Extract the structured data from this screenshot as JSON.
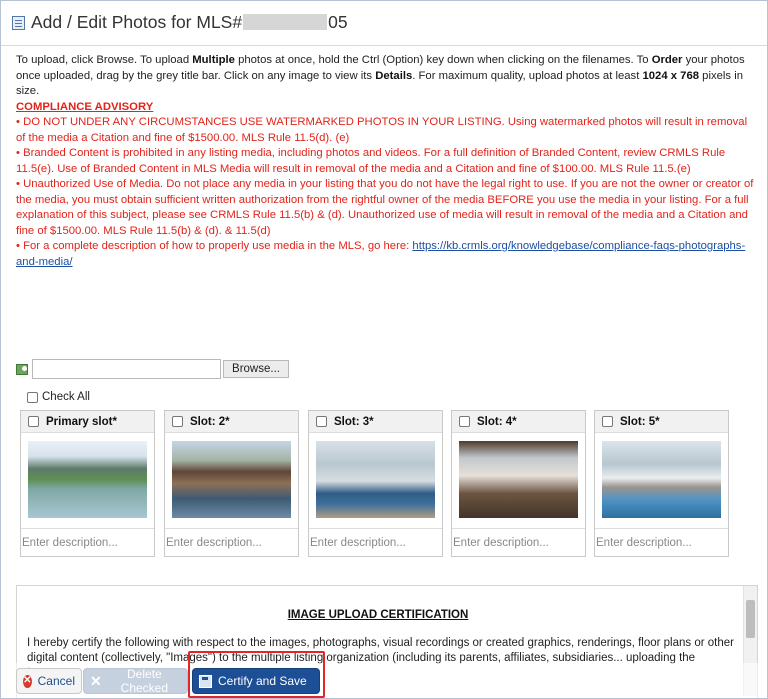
{
  "window": {
    "title_prefix": "Add / Edit Photos for MLS#",
    "title_suffix": "05"
  },
  "instructions": {
    "p1": "To upload, click Browse. To upload ",
    "b1": "Multiple",
    "p2": " photos at once, hold the Ctrl (Option) key down when clicking on the filenames. To ",
    "b2": "Order",
    "p3": " your photos once uploaded, drag by the grey title bar. Click on any image to view its ",
    "b3": "Details",
    "p4": ". For maximum quality, upload photos at least ",
    "b4": "1024 x 768",
    "p5": " pixels in size."
  },
  "advisory": {
    "heading": "COMPLIANCE ADVISORY",
    "item1": "• DO NOT UNDER ANY CIRCUMSTANCES USE WATERMARKED PHOTOS IN YOUR LISTING. Using watermarked photos will result in removal of the media a Citation and fine of $1500.00. MLS Rule 11.5(d). (e)",
    "item2": "• Branded Content is prohibited in any listing media, including photos and videos. For a full definition of Branded Content, review CRMLS Rule 11.5(e). Use of Branded Content in MLS Media will result in removal of the media and a Citation and fine of $100.00. MLS Rule 11.5.(e)",
    "item3": "• Unauthorized Use of Media. Do not place any media in your listing that you do not have the legal right to use. If you are not the owner or creator of the media, you must obtain sufficient written authorization from the rightful owner of the media BEFORE you use the media in your listing. For a full explanation of this subject, please see CRMLS Rule 11.5(b) & (d). Unauthorized use of media will result in removal of the media and a Citation and fine of $1500.00. MLS Rule 11.5(b) & (d). & 11.5(d)",
    "item4_text": "• For a complete description of how to properly use media in the MLS, go here: ",
    "item4_link": "https://kb.crmls.org/knowledgebase/compliance-faqs-photographs-and-media/"
  },
  "uploader": {
    "file_value": "",
    "browse_label": "Browse..."
  },
  "check_all_label": "Check All",
  "slots": [
    {
      "label": "Primary slot*",
      "placeholder": "Enter description...",
      "photo": "house-lake-photo"
    },
    {
      "label": "Slot: 2*",
      "placeholder": "Enter description...",
      "photo": "exterior-deck-photo"
    },
    {
      "label": "Slot: 3*",
      "placeholder": "Enter description...",
      "photo": "bedroom-photo"
    },
    {
      "label": "Slot: 4*",
      "placeholder": "Enter description...",
      "photo": "dining-room-photo"
    },
    {
      "label": "Slot: 5*",
      "placeholder": "Enter description...",
      "photo": "porch-photo"
    }
  ],
  "certification": {
    "title": "IMAGE UPLOAD CERTIFICATION",
    "body": "I hereby certify the following with respect to the images, photographs, visual recordings or created graphics, renderings, floor plans or other digital content (collectively, \"Images\") to the multiple listing organization (including its parents, affiliates, subsidiaries... uploading the Images:"
  },
  "toolbar": {
    "cancel_label": "Cancel",
    "delete_label": "Delete Checked",
    "save_label": "Certify and Save"
  },
  "colors": {
    "advisory_red": "#e2231a",
    "link_blue": "#1d4fa3",
    "save_button": "#1c4f95",
    "highlight": "#e0262b"
  }
}
